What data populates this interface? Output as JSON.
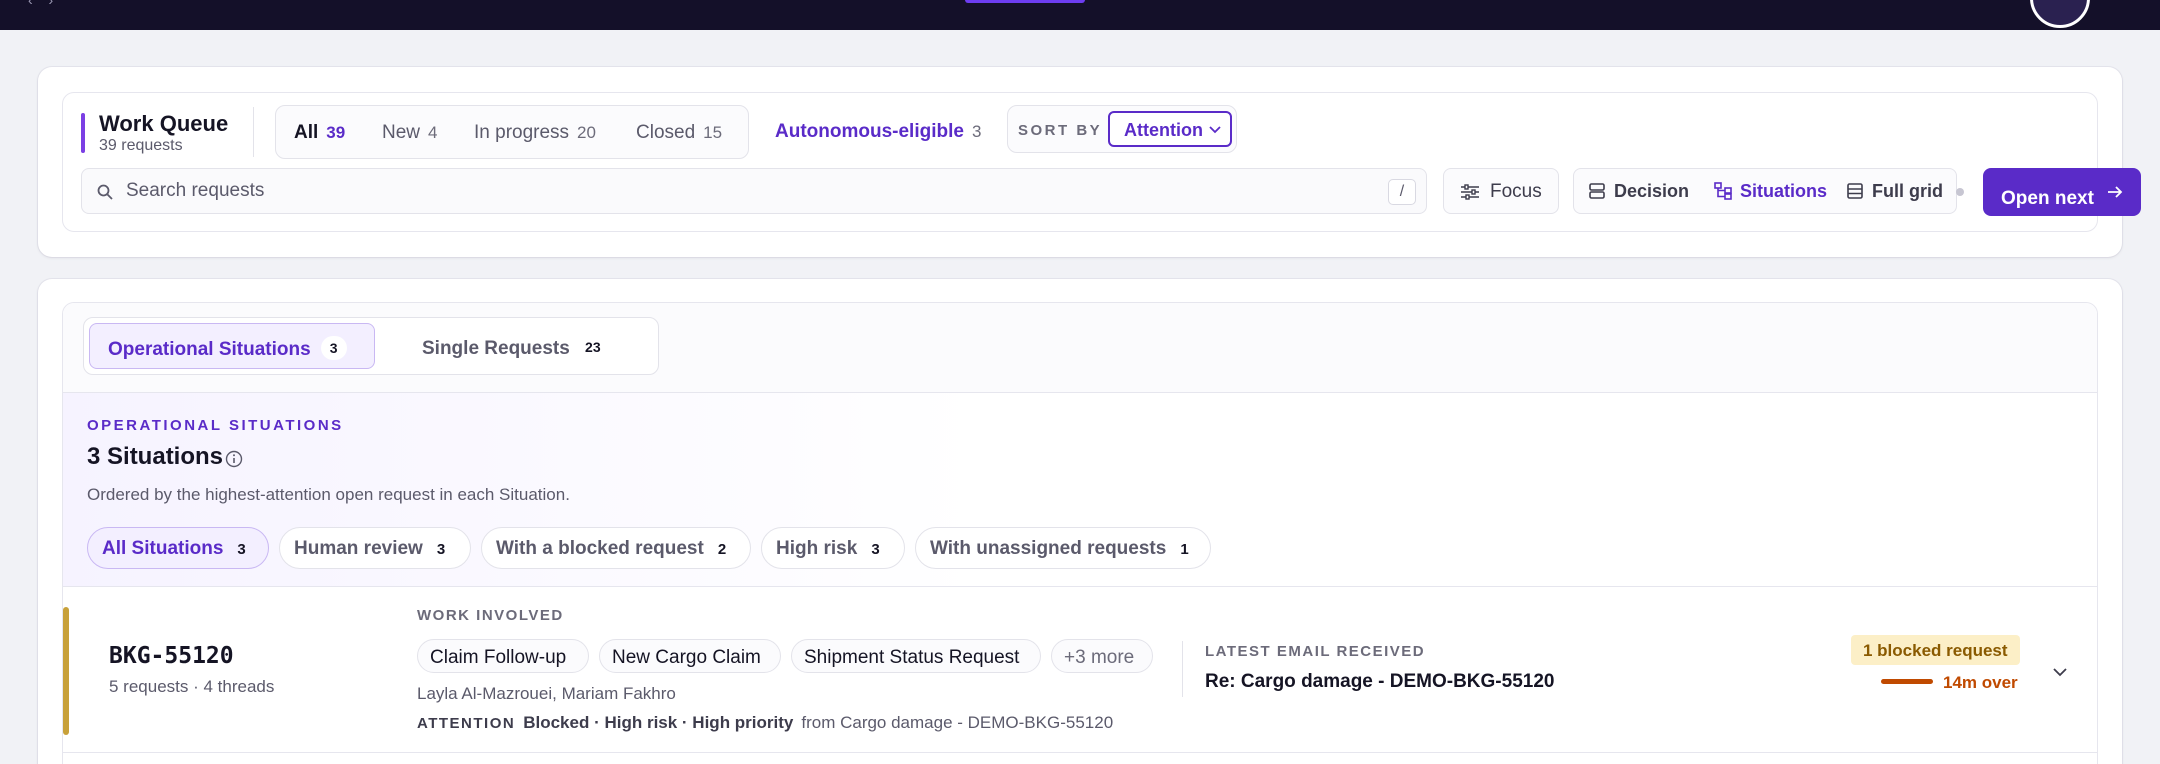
{
  "header": {},
  "queue": {
    "title": "Work Queue",
    "subtitle": "39 requests",
    "status_tabs": [
      {
        "label": "All",
        "count": "39"
      },
      {
        "label": "New",
        "count": "4"
      },
      {
        "label": "In progress",
        "count": "20"
      },
      {
        "label": "Closed",
        "count": "15"
      }
    ],
    "autonomous": {
      "label": "Autonomous-eligible",
      "count": "3"
    },
    "sort": {
      "label": "SORT BY",
      "value": "Attention"
    },
    "search": {
      "placeholder": "Search requests",
      "shortcut": "/"
    },
    "focus_label": "Focus",
    "views": [
      {
        "label": "Decision",
        "icon": "rows-icon"
      },
      {
        "label": "Situations",
        "icon": "hierarchy-icon"
      },
      {
        "label": "Full grid",
        "icon": "grid-icon"
      }
    ],
    "open_next": "Open next"
  },
  "tabs": [
    {
      "label": "Operational Situations",
      "count": "3"
    },
    {
      "label": "Single Requests",
      "count": "23"
    }
  ],
  "overview": {
    "kicker": "OPERATIONAL SITUATIONS",
    "title": "3 Situations",
    "description": "Ordered by the highest-attention open request in each Situation.",
    "filters": [
      {
        "label": "All Situations",
        "count": "3"
      },
      {
        "label": "Human review",
        "count": "3"
      },
      {
        "label": "With a blocked request",
        "count": "2"
      },
      {
        "label": "High risk",
        "count": "3"
      },
      {
        "label": "With unassigned requests",
        "count": "1"
      }
    ]
  },
  "situation": {
    "id": "BKG-55120",
    "meta": "5 requests · 4 threads",
    "work_kicker": "WORK INVOLVED",
    "work_tags": [
      "Claim Follow-up",
      "New Cargo Claim",
      "Shipment Status Request",
      "+3 more"
    ],
    "people": "Layla Al-Mazrouei, Mariam Fakhro",
    "attention_label": "ATTENTION",
    "attention_value": "Blocked · High risk · High priority",
    "attention_source": "from Cargo damage - DEMO-BKG-55120",
    "email_kicker": "LATEST EMAIL RECEIVED",
    "email_subject": "Re: Cargo damage - DEMO-BKG-55120",
    "blocked_badge": "1 blocked request",
    "overdue": "14m over"
  },
  "colors": {
    "accent": "#5a2bc8",
    "situation_accent": "#c8a13a",
    "overdue": "#c04a00",
    "topbar": "#141029"
  }
}
